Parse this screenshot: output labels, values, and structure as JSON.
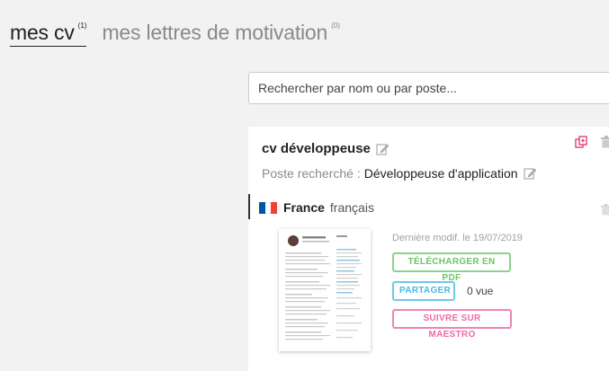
{
  "tabs": {
    "cv": {
      "label": "mes cv",
      "count": "(1)"
    },
    "letters": {
      "label": "mes lettres de motivation",
      "count": "(0)"
    }
  },
  "search": {
    "placeholder": "Rechercher par nom ou par poste..."
  },
  "card": {
    "title": "cv développeuse",
    "poste_label": "Poste recherché :",
    "poste_value": "Développeuse d'application",
    "language": {
      "country": "France",
      "language": "français",
      "flag_colors": [
        "#0055a4",
        "#ffffff",
        "#ef4135"
      ]
    },
    "last_modified": "Dernière modif. le 19/07/2019",
    "buttons": {
      "pdf": "TÉLÉCHARGER EN PDF",
      "share": "PARTAGER",
      "maestro": "SUIVRE SUR MAESTRO"
    },
    "views": "0 vue"
  },
  "colors": {
    "pdf": "#6ac667",
    "share": "#4ab8e0",
    "maestro": "#ec6aa8",
    "duplicate_icon": "#e0407a"
  }
}
